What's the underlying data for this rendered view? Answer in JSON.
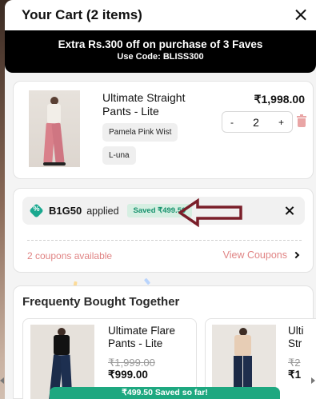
{
  "header": {
    "title": "Your Cart (2 items)"
  },
  "promo": {
    "line1": "Extra Rs.300 off on purchase of 3 Faves",
    "line2": "Use Code: BLISS300"
  },
  "cart_item": {
    "name": "Ultimate Straight Pants - Lite",
    "price": "₹1,998.00",
    "color": "Pamela Pink Wist",
    "size": "L-una",
    "qty_minus": "-",
    "quantity": "2",
    "qty_plus": "+"
  },
  "coupon": {
    "code": "B1G50",
    "applied_text": "applied",
    "saved_text": "Saved ₹499.50",
    "available_text": "2 coupons available",
    "view_label": "View Coupons"
  },
  "fbt": {
    "title": "Frequenty Bought Together",
    "items": [
      {
        "name": "Ultimate Flare Pants - Lite",
        "old_price": "₹1,999.00",
        "new_price": "₹999.00"
      },
      {
        "name": "Ulti Str",
        "old_price": "₹2",
        "new_price": "₹1"
      }
    ]
  },
  "savings_bar": {
    "text": "₹499.50 Saved so far!"
  },
  "colors": {
    "accent_green": "#1ea880",
    "coupon_link": "#e08484",
    "promo_bg": "#000000",
    "arrow": "#7a1f2a"
  },
  "icons": [
    "close-icon",
    "trash-icon",
    "coupon-badge-icon",
    "remove-coupon-icon",
    "chevron-right-icon",
    "annotation-arrow-icon"
  ]
}
